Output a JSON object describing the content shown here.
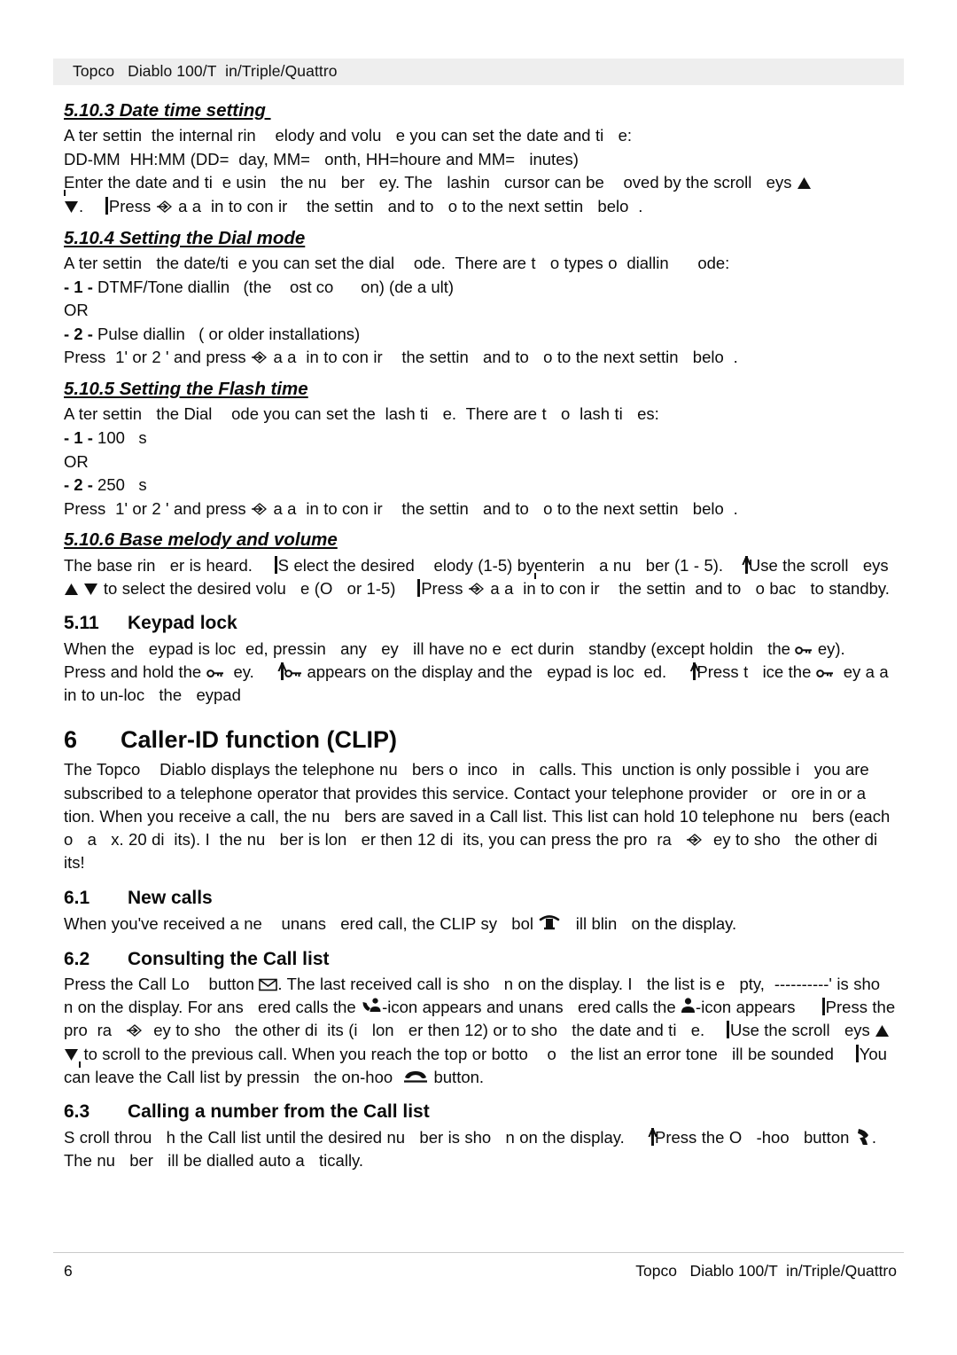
{
  "header": {
    "text": "Topco   Diablo 100/T  in/Triple/Quattro"
  },
  "footer": {
    "page_number": "6",
    "text": "Topco   Diablo 100/T  in/Triple/Quattro"
  },
  "sections": {
    "s_5_10_3": {
      "heading": "5.10.3 Date time setting ",
      "p1_a": "A ter settin  the internal rin    elody and volu   e you can set the date and ti   e:",
      "p1_b": "DD-MM  HH:MM (DD=  day, MM=   onth, HH=houre and MM=   inutes)",
      "p1_c": "Enter the date and ti  e usin   the nu   ber   ey. The   lashin   cursor can be    oved by the scroll   eys ",
      "p1_d": "Press ",
      "p1_e": " a a  in to con ir    the settin   and to   o to the next settin   belo  ."
    },
    "s_5_10_4": {
      "heading": "5.10.4 Setting the Dial mode",
      "p1": "A ter settin   the date/ti  e you can set the dial    ode.  There are t   o types o  diallin      ode:",
      "item1_bullet": "- 1 - ",
      "item1": "DTMF/Tone diallin   (the    ost co      on) (de a ult)",
      "or": "OR",
      "item2_bullet": "- 2 - ",
      "item2": "Pulse diallin   ( or older installations)",
      "press_a": "Press  1' or 2 ' and press ",
      "press_b": " a a  in to con ir    the settin   and to   o to the next settin   belo  ."
    },
    "s_5_10_5": {
      "heading": "5.10.5 Setting the Flash time",
      "p1": "A ter settin   the Dial    ode you can set the  lash ti   e.  There are t   o  lash ti   es:",
      "item1_bullet": "- 1 - ",
      "item1": "100   s",
      "or": "OR",
      "item2_bullet": "- 2 - ",
      "item2": "250   s",
      "press_a": "Press  1' or 2 ' and press ",
      "press_b": " a a  in to con ir    the settin   and to   o to the next settin   belo  ."
    },
    "s_5_10_6": {
      "heading": "5.10.6 Base melody and volume",
      "t1": "The base rin   er is heard.",
      "t2": "S elect the desired    elody (1-5) by",
      "t3": "enterin   a nu   ber (1 - 5).",
      "t4": "Use the scroll   eys ",
      "t5": " to select the desired volu   e (O   or 1-5)",
      "t6": "Press ",
      "t7": " a a  in to con ir    the settin  and to   o bac   to standby."
    },
    "s_5_11": {
      "number": "5.11",
      "heading": "Keypad lock",
      "p1_a": "When the   eypad is loc  ed, pressin   any   ey   ill have no e  ect durin   standby (except holdin   the ",
      "p1_b": " ey).",
      "p2_a": "Press and hold the ",
      "p2_b": "  ey.",
      "p2_c": " appears on the display and the   eypad is loc  ed.",
      "p2_d": "Press t   ice the ",
      "p2_e": "  ey a a  in to un-loc   the   eypad"
    },
    "s_6": {
      "number": "6",
      "heading": "Caller-ID function (CLIP)",
      "p1": "The Topco    Diablo displays the telephone nu   bers o  inco   in   calls. This  unction is only possible i   you are subscribed to a telephone operator that provides this service. Contact your telephone provider   or   ore in or a  tion. When you receive a call, the nu   bers are saved in a Call list. This list can hold 10 telephone nu   bers (each o   a   x. 20 di  its). I  the nu   ber is lon   er then 12 di  its, you can press the pro  ra   ",
      "p1_end": "  ey to sho   the other di  its!"
    },
    "s_6_1": {
      "number": "6.1",
      "heading": "New calls",
      "p1_a": "When you've received a ne    unans   ered call, the CLIP sy   bol ",
      "p1_b": "   ill blin   on the display."
    },
    "s_6_2": {
      "number": "6.2",
      "heading": "Consulting the Call list",
      "t1": "Press the Call Lo    button ",
      "t2": ". The last received call is sho   n on the display. I   the list is e   pty,  ----------' is sho   n on the display. For ans   ered calls the ",
      "t3": "-icon appears and unans   ered calls the ",
      "t4": "-icon appears",
      "t5": "Press the pro  ra   ",
      "t6": "  ey to sho   the other di  its (i   lon   er then 12) or to sho   the date and ti   e.",
      "t7": "Use the scroll   eys ",
      "t8": " to scroll to the previous call. When you reach the top or botto    o   the list an error tone   ill be sounded",
      "t9": "You can leave the Call list by pressin   the on-hoo  ",
      "t10": " button."
    },
    "s_6_3": {
      "number": "6.3",
      "heading": "Calling a number from the Call list",
      "t1": "S croll throu   h the Call list until the desired nu   ber is sho   n on the display.",
      "t2": "Press the O   -hoo   button ",
      "t3": ". The nu   ber   ill be dialled auto a   tically."
    }
  },
  "icons": {
    "program_key": "program-key-icon",
    "key": "key-icon",
    "envelope": "envelope-icon",
    "phone_clip": "clip-phone-icon",
    "answered_call": "answered-call-icon",
    "unanswered_call": "unanswered-call-icon",
    "on_hook": "on-hook-icon",
    "off_hook": "off-hook-icon",
    "scroll_up": "scroll-up-triangle-icon",
    "scroll_down": "scroll-down-triangle-icon"
  },
  "colors": {
    "text": "#0b0b0b",
    "header_band": "#eeeeee",
    "page_background": "#ffffff"
  }
}
